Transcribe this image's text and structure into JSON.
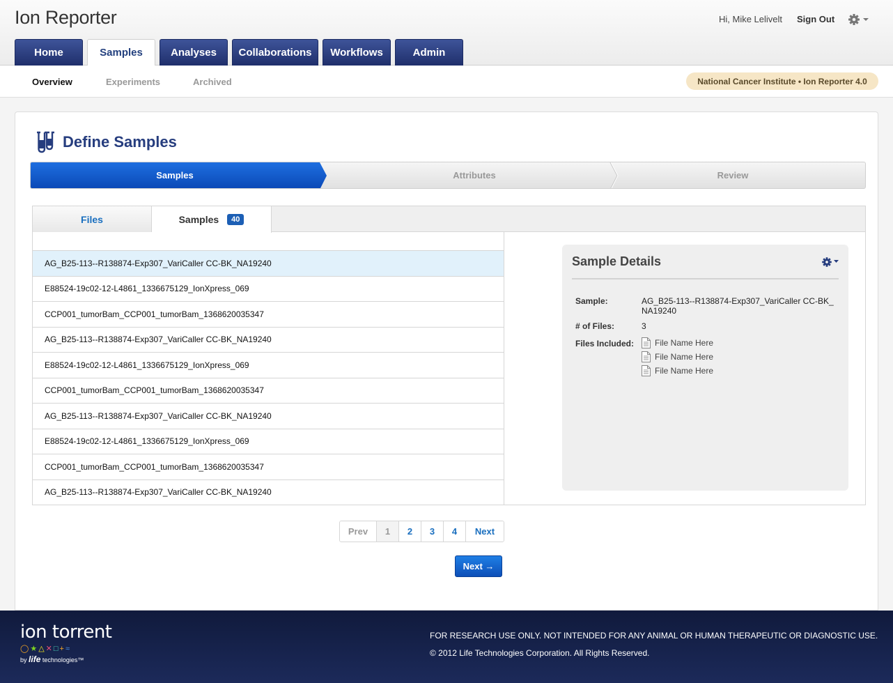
{
  "header": {
    "app_title": "Ion Reporter",
    "greeting": "Hi, Mike Lelivelt",
    "sign_out": "Sign Out",
    "settings_icon": "gear-icon"
  },
  "main_tabs": [
    {
      "label": "Home",
      "active": false
    },
    {
      "label": "Samples",
      "active": true
    },
    {
      "label": "Analyses",
      "active": false
    },
    {
      "label": "Collaborations",
      "active": false
    },
    {
      "label": "Workflows",
      "active": false
    },
    {
      "label": "Admin",
      "active": false
    }
  ],
  "sub_nav": {
    "items": [
      "Overview",
      "Experiments",
      "Archived"
    ],
    "active": "Overview",
    "org_badge": "National Cancer Institute  •  Ion Reporter 4.0"
  },
  "page": {
    "title": "Define Samples",
    "title_icon": "test-tubes-icon"
  },
  "wizard": {
    "steps": [
      "Samples",
      "Attributes",
      "Review"
    ],
    "active_step": "Samples"
  },
  "panel_tabs": {
    "files_label": "Files",
    "samples_label": "Samples",
    "samples_count": "40",
    "active": "Samples"
  },
  "samples": [
    "AG_B25-113--R138874-Exp307_VariCaller CC-BK_NA19240",
    "E88524-19c02-12-L4861_1336675129_IonXpress_069",
    "CCP001_tumorBam_CCP001_tumorBam_1368620035347",
    "AG_B25-113--R138874-Exp307_VariCaller CC-BK_NA19240",
    "E88524-19c02-12-L4861_1336675129_IonXpress_069",
    "CCP001_tumorBam_CCP001_tumorBam_1368620035347",
    "AG_B25-113--R138874-Exp307_VariCaller CC-BK_NA19240",
    "E88524-19c02-12-L4861_1336675129_IonXpress_069",
    "CCP001_tumorBam_CCP001_tumorBam_1368620035347",
    "AG_B25-113--R138874-Exp307_VariCaller CC-BK_NA19240"
  ],
  "selected_sample_index": 0,
  "details": {
    "title": "Sample Details",
    "sample_label": "Sample:",
    "sample_value_line1": "AG_B25-113--R138874-Exp307_VariCaller CC-BK_",
    "sample_value_line2": "NA19240",
    "files_count_label": "# of Files:",
    "files_count_value": "3",
    "files_included_label": "Files Included:",
    "files": [
      "File Name Here",
      "File Name Here",
      "File Name Here"
    ]
  },
  "pagination": {
    "prev": "Prev",
    "pages": [
      "1",
      "2",
      "3",
      "4"
    ],
    "current": "1",
    "next": "Next"
  },
  "next_button": "Next →",
  "footer": {
    "logo_main": "ion torrent",
    "logo_by": "by",
    "logo_brand": "life",
    "logo_suffix": "technologies™",
    "disclaimer": "FOR RESEARCH USE ONLY. NOT INTENDED FOR ANY ANIMAL OR HUMAN THERAPEUTIC OR DIAGNOSTIC USE.",
    "copyright": "© 2012 Life Technologies Corporation. All Rights Reserved."
  },
  "colors": {
    "primary_nav": "#2b3f84",
    "wizard_active": "#0d55c8",
    "link_blue": "#1a6fbf",
    "selected_row": "#e1f1fb",
    "footer": "#15214a"
  }
}
